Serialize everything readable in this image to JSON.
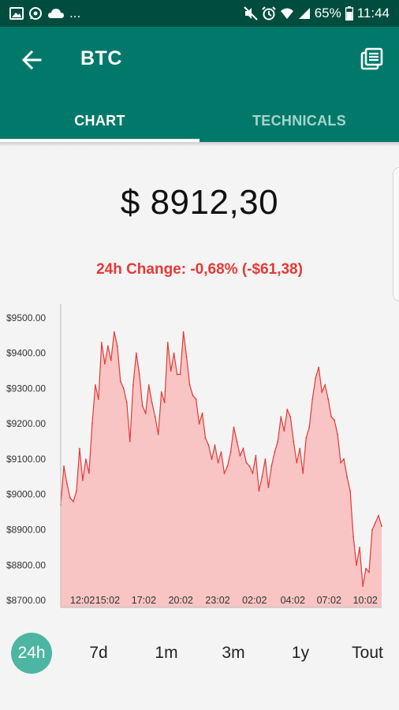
{
  "status_bar": {
    "left_dots": "...",
    "battery": "65%",
    "time": "11:44"
  },
  "app_bar": {
    "title": "BTC",
    "back_icon": "arrow-left-icon",
    "news_icon": "news-icon"
  },
  "tabs": [
    {
      "label": "CHART",
      "active": true
    },
    {
      "label": "TECHNICALS",
      "active": false
    }
  ],
  "price": "$ 8912,30",
  "change": "24h Change: -0,68% (-$61,38)",
  "colors": {
    "primary_dark": "#004d40",
    "primary": "#00796b",
    "accent": "#4db6a3",
    "negative": "#e53935",
    "chart_line": "#e53935",
    "chart_fill": "#f8c4c4"
  },
  "chart_data": {
    "type": "area",
    "ylim": [
      8680,
      9540
    ],
    "y_ticks": [
      "$9500.00",
      "$9400.00",
      "$9300.00",
      "$9200.00",
      "$9100.00",
      "$9000.00",
      "$8900.00",
      "$8800.00",
      "$8700.00"
    ],
    "y_tick_values": [
      9500,
      9400,
      9300,
      9200,
      9100,
      9000,
      8900,
      8800,
      8700
    ],
    "x_ticks": [
      "12:02",
      "15:02",
      "17:02",
      "20:02",
      "23:02",
      "02:02",
      "04:02",
      "07:02",
      "10:02"
    ],
    "x_tick_positions": [
      0.068,
      0.146,
      0.259,
      0.374,
      0.489,
      0.604,
      0.723,
      0.836,
      0.949
    ],
    "series": [
      {
        "values": [
          8970,
          9080,
          9030,
          8990,
          8980,
          9010,
          9130,
          9040,
          9100,
          9060,
          9200,
          9310,
          9270,
          9430,
          9370,
          9420,
          9380,
          9460,
          9420,
          9320,
          9300,
          9260,
          9150,
          9310,
          9400,
          9340,
          9250,
          9230,
          9310,
          9260,
          9220,
          9170,
          9290,
          9260,
          9430,
          9350,
          9400,
          9340,
          9340,
          9460,
          9390,
          9310,
          9280,
          9270,
          9200,
          9230,
          9160,
          9140,
          9100,
          9140,
          9090,
          9120,
          9060,
          9080,
          9120,
          9190,
          9150,
          9110,
          9130,
          9090,
          9080,
          9060,
          9110,
          9010,
          9050,
          9100,
          9020,
          9080,
          9120,
          9150,
          9220,
          9180,
          9240,
          9220,
          9150,
          9090,
          9130,
          9060,
          9160,
          9190,
          9270,
          9330,
          9360,
          9290,
          9310,
          9270,
          9220,
          9210,
          9170,
          9090,
          9100,
          9050,
          9010,
          8880,
          8800,
          8850,
          8740,
          8790,
          8780,
          8900,
          8920,
          8940,
          8910
        ]
      }
    ],
    "grid": false
  },
  "ranges": [
    {
      "label": "24h",
      "selected": true
    },
    {
      "label": "7d",
      "selected": false
    },
    {
      "label": "1m",
      "selected": false
    },
    {
      "label": "3m",
      "selected": false
    },
    {
      "label": "1y",
      "selected": false
    },
    {
      "label": "Tout",
      "selected": false
    }
  ]
}
